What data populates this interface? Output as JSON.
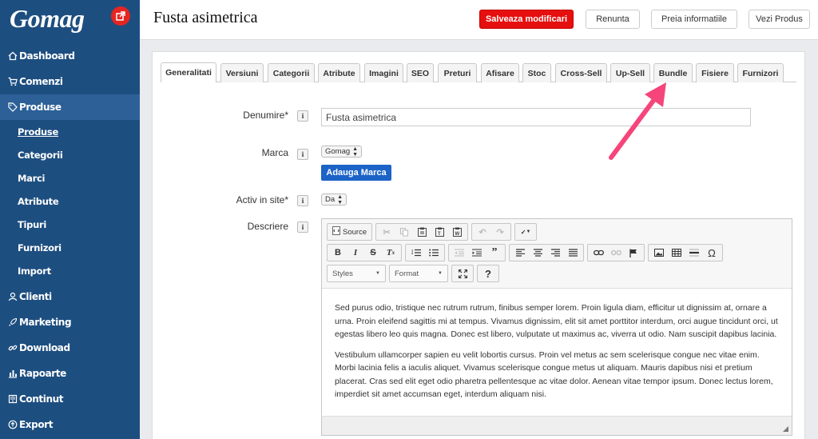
{
  "app": {
    "logo": "Gomag"
  },
  "sidebar": {
    "items": [
      {
        "label": "Dashboard",
        "icon": "home-icon"
      },
      {
        "label": "Comenzi",
        "icon": "cart-icon"
      },
      {
        "label": "Produse",
        "icon": "tag-icon",
        "active": true
      },
      {
        "label": "Clienti",
        "icon": "user-icon"
      },
      {
        "label": "Marketing",
        "icon": "rocket-icon"
      },
      {
        "label": "Download",
        "icon": "link-icon"
      },
      {
        "label": "Rapoarte",
        "icon": "bar-chart-icon"
      },
      {
        "label": "Continut",
        "icon": "book-icon"
      },
      {
        "label": "Export",
        "icon": "export-icon"
      }
    ],
    "subitems": [
      "Produse",
      "Categorii",
      "Marci",
      "Atribute",
      "Tipuri",
      "Furnizori",
      "Import"
    ]
  },
  "header": {
    "title": "Fusta asimetrica",
    "save_label": "Salveaza modificari",
    "cancel_label": "Renunta",
    "fetch_label": "Preia informatiile",
    "view_label": "Vezi Produs"
  },
  "tabs": [
    "Generalitati",
    "Versiuni",
    "Categorii",
    "Atribute",
    "Imagini",
    "SEO",
    "Preturi",
    "Afisare",
    "Stoc",
    "Cross-Sell",
    "Up-Sell",
    "Bundle",
    "Fisiere",
    "Furnizori"
  ],
  "form": {
    "name_label": "Denumire*",
    "name_value": "Fusta asimetrica",
    "brand_label": "Marca",
    "brand_value": "Gomag",
    "add_brand_label": "Adauga Marca",
    "active_label": "Activ in site*",
    "active_value": "Da",
    "description_label": "Descriere",
    "info_glyph": "i"
  },
  "editor": {
    "source_label": "Source",
    "styles_label": "Styles",
    "format_label": "Format",
    "help_label": "?",
    "paragraphs": [
      "Sed purus odio, tristique nec rutrum rutrum, finibus semper lorem. Proin ligula diam, efficitur ut dignissim at, ornare a urna. Proin eleifend sagittis mi at tempus. Vivamus dignissim, elit sit amet porttitor interdum, orci augue tincidunt orci, ut egestas libero leo quis magna. Donec est libero, vulputate ut maximus ac, viverra ut odio. Nam suscipit dapibus lacinia.",
      "Vestibulum ullamcorper sapien eu velit lobortis cursus. Proin vel metus ac sem scelerisque congue nec vitae enim. Morbi lacinia felis a iaculis aliquet. Vivamus scelerisque congue metus ut aliquam. Mauris dapibus nisi et pretium placerat. Cras sed elit eget odio pharetra pellentesque ac vitae dolor. Aenean vitae tempor ipsum. Donec lectus lorem, imperdiet sit amet accumsan eget, interdum aliquam nisi."
    ]
  },
  "colors": {
    "sidebar": "#1d4e80",
    "sidebar_active": "#2c6097",
    "primary_button": "#e60f0f",
    "blue_button": "#1c63c7",
    "annotation_arrow": "#f5457a"
  }
}
